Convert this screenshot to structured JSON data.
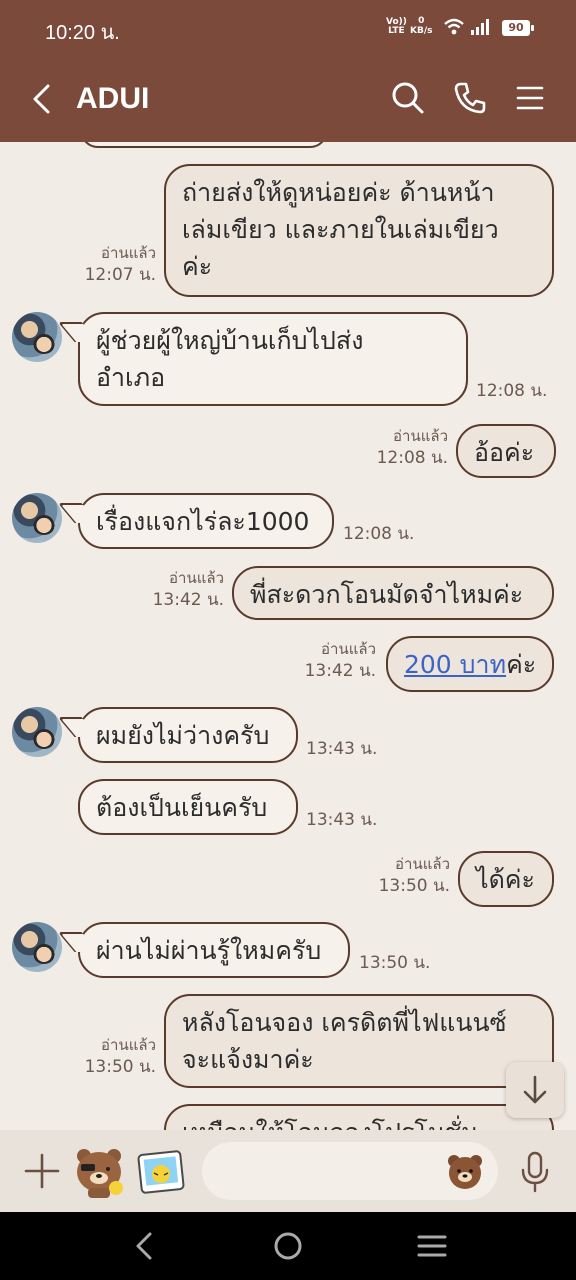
{
  "status_bar": {
    "time": "10:20 น.",
    "net_top": "Vo))",
    "net_bottom": "LTE",
    "speed_value": "0",
    "speed_unit": "KB/s",
    "battery": "90"
  },
  "header": {
    "title": "ADUI",
    "icons": [
      "back-arrow-icon",
      "search-icon",
      "phone-icon",
      "menu-icon"
    ],
    "background": "#7b4a3b"
  },
  "messages": [
    {
      "side": "out",
      "text_lines": [
        "ถ่ายส่งให้ดูหน่อยค่ะ ด้านหน้า",
        "เล่มเขียว และภายในเล่มเขียว",
        "ค่ะ"
      ],
      "read": "อ่านแล้ว",
      "time": "12:07 น."
    },
    {
      "side": "in",
      "text_lines": [
        "ผู้ช่วยผู้ใหญ่บ้านเก็บไปส่ง",
        "อำเภอ"
      ],
      "time": "12:08 น."
    },
    {
      "side": "out",
      "text_lines": [
        "อ้อค่ะ"
      ],
      "read": "อ่านแล้ว",
      "time": "12:08 น."
    },
    {
      "side": "in",
      "text_lines": [
        "เรื่องแจกไร่ละ1000"
      ],
      "time": "12:08 น."
    },
    {
      "side": "out",
      "text_lines": [
        "พี่สะดวกโอนมัดจำไหมค่ะ"
      ],
      "read": "อ่านแล้ว",
      "time": "13:42 น."
    },
    {
      "side": "out",
      "link_text": "200 บาท",
      "suffix": "ค่ะ",
      "read": "อ่านแล้ว",
      "time": "13:42 น."
    },
    {
      "side": "in",
      "text_lines": [
        "ผมยังไม่ว่างครับ"
      ],
      "time": "13:43 น."
    },
    {
      "side": "in",
      "text_lines": [
        "ต้องเป็นเย็นครับ"
      ],
      "time": "13:43 น."
    },
    {
      "side": "out",
      "text_lines": [
        "ได้ค่ะ"
      ],
      "read": "อ่านแล้ว",
      "time": "13:50 น."
    },
    {
      "side": "in",
      "text_lines": [
        "ผ่านไม่ผ่านรู้ใหมครับ"
      ],
      "time": "13:50 น."
    },
    {
      "side": "out",
      "text_lines": [
        "หลังโอนจอง  เครดิตพี่ไฟแนนซ์",
        "จะแจ้งมาค่ะ"
      ],
      "read": "อ่านแล้ว",
      "time": "13:50 น."
    },
    {
      "side": "out",
      "text_lines": [
        "เหมือนให้โอนจองโปรโมชั่น"
      ],
      "partial": true
    }
  ],
  "input_bar": {
    "placeholder": "",
    "icons": [
      "plus-icon",
      "brown-bear-sticker-icon",
      "photo-sticker-icon",
      "bear-emoji-icon",
      "microphone-icon"
    ]
  },
  "nav_bar": {
    "icons": [
      "nav-back-icon",
      "nav-home-icon",
      "nav-recents-icon"
    ]
  },
  "colors": {
    "accent": "#7b4a3b",
    "chat_background": "#f1ece6",
    "bubble_border": "#5a3a2c",
    "link": "#3b64c8"
  }
}
